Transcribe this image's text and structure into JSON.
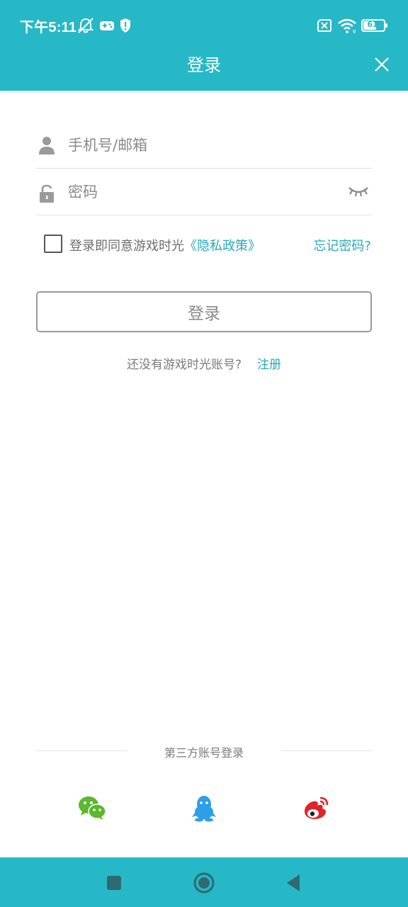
{
  "status_bar": {
    "time": "下午5:11",
    "battery": "61",
    "icons": [
      "notification-muted-icon",
      "game-controller-icon",
      "shield-icon",
      "sim-off-icon",
      "wifi-icon",
      "battery-icon"
    ]
  },
  "header": {
    "title": "登录",
    "close_icon": "close-icon"
  },
  "form": {
    "account_placeholder": "手机号/邮箱",
    "account_value": "",
    "password_placeholder": "密码",
    "password_value": "",
    "agree_prefix": "登录即同意游戏时光",
    "privacy_link": "《隐私政策》",
    "agree_checked": false,
    "forgot_password": "忘记密码?",
    "login_button": "登录"
  },
  "register": {
    "prompt": "还没有游戏时光账号?",
    "link": "注册"
  },
  "third_party": {
    "label": "第三方账号登录",
    "providers": [
      "wechat-icon",
      "qq-icon",
      "weibo-icon"
    ]
  },
  "colors": {
    "accent": "#26b8c6",
    "link": "#26a9b7",
    "wechat": "#5cb82e",
    "qq": "#2d9ee8",
    "weibo": "#e0242a"
  }
}
